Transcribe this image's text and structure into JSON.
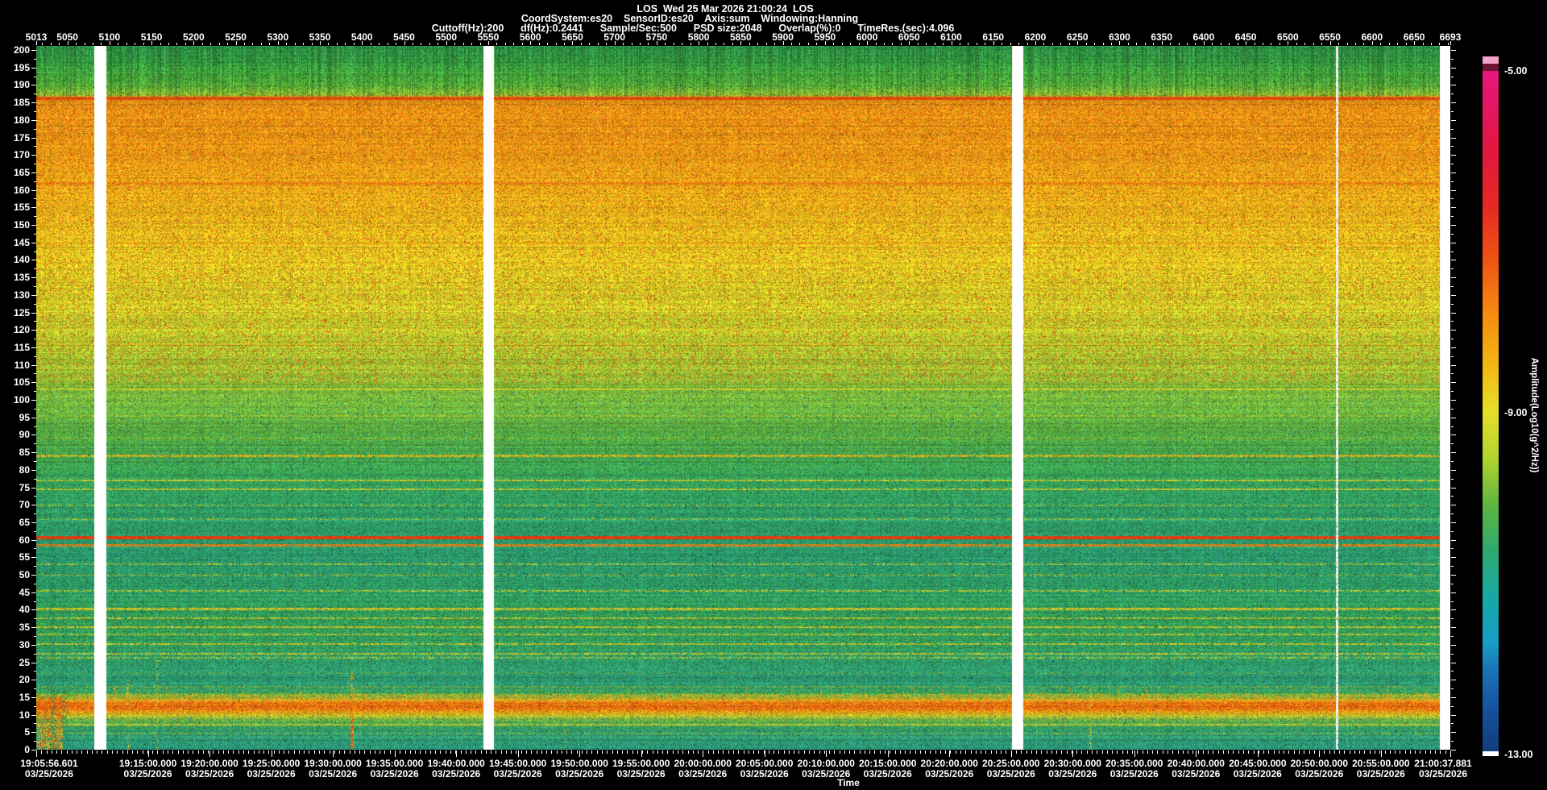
{
  "window": {
    "background": "#000000",
    "text_color": "#ffffff"
  },
  "header": {
    "title": "LOS  Wed 25 Mar 2026 21:00:24  LOS",
    "params_line": "CoordSystem:es20    SensorID:es20    Axis:sum    Windowing:Hanning",
    "settings_line": "Cuttoff(Hz):200      df(Hz):0.2441      Sample/Sec:500      PSD size:2048      Overlap(%):0      TimeRes.(sec):4.096"
  },
  "top_axis": {
    "range": [
      5013,
      6693
    ],
    "minor_tick_step": 10,
    "tick_labels": [
      5013,
      5050,
      5100,
      5150,
      5200,
      5250,
      5300,
      5350,
      5400,
      5450,
      5500,
      5550,
      5600,
      5650,
      5700,
      5750,
      5800,
      5850,
      5900,
      5950,
      6000,
      6050,
      6100,
      6150,
      6200,
      6250,
      6300,
      6350,
      6400,
      6450,
      6500,
      6550,
      6600,
      6650,
      6693
    ]
  },
  "left_axis": {
    "range_hz": [
      0,
      200
    ],
    "minor_tick_step": 2.5,
    "tick_labels": [
      200,
      195,
      190,
      185,
      180,
      175,
      170,
      165,
      160,
      155,
      150,
      145,
      140,
      135,
      130,
      125,
      120,
      115,
      110,
      105,
      100,
      95,
      90,
      85,
      80,
      75,
      70,
      65,
      60,
      55,
      50,
      45,
      40,
      35,
      30,
      25,
      20,
      15,
      10,
      5,
      0
    ]
  },
  "bottom_axis": {
    "label": "Time",
    "date_line": "03/25/2026",
    "start_time": "19:05:56.601",
    "end_time": "21:00:37.881",
    "interval_tick_times": [
      "19:15:00.000",
      "19:20:00.000",
      "19:25:00.000",
      "19:30:00.000",
      "19:35:00.000",
      "19:40:00.000",
      "19:45:00.000",
      "19:50:00.000",
      "19:55:00.000",
      "20:00:00.000",
      "20:05:00.000",
      "20:10:00.000",
      "20:15:00.000",
      "20:20:00.000",
      "20:25:00.000",
      "20:30:00.000",
      "20:35:00.000",
      "20:40:00.000",
      "20:45:00.000",
      "20:50:00.000",
      "20:55:00.000"
    ],
    "minor_tick_seconds": 24.576
  },
  "colorbar": {
    "title": "Amplitude(Log10(g^2/Hz))",
    "tick_labels": [
      "-5.00",
      "-9.00",
      "-13.00"
    ],
    "value_range": [
      -13,
      -5
    ],
    "top_cap_colors": [
      "#f2a2c6",
      "#701434"
    ],
    "bottom_cap_color": "#ffffff",
    "gradient_stops": [
      [
        "0%",
        "#e6187c"
      ],
      [
        "6%",
        "#e41560"
      ],
      [
        "12%",
        "#e2173e"
      ],
      [
        "20%",
        "#e62922"
      ],
      [
        "28%",
        "#ee5514"
      ],
      [
        "36%",
        "#f68c0e"
      ],
      [
        "44%",
        "#f2bc14"
      ],
      [
        "50%",
        "#e6de2a"
      ],
      [
        "57%",
        "#b2d42e"
      ],
      [
        "64%",
        "#5cb440"
      ],
      [
        "71%",
        "#2ca873"
      ],
      [
        "78%",
        "#16a8a8"
      ],
      [
        "84%",
        "#189ec6"
      ],
      [
        "88%",
        "#1a74b4"
      ],
      [
        "94%",
        "#16509a"
      ],
      [
        "100%",
        "#123c7c"
      ]
    ]
  },
  "chart_data": {
    "type": "heatmap",
    "subtype": "spectrogram",
    "title": "LOS  Wed 25 Mar 2026 21:00:24  LOS",
    "station": "LOS",
    "x_top_records": {
      "min": 5013,
      "max": 6693,
      "record_duration_sec": 4.096
    },
    "x_time": {
      "start": "19:05:56.601 03/25/2026",
      "end": "21:00:37.881 03/25/2026",
      "label": "Time"
    },
    "y_frequency_hz": [
      0,
      200
    ],
    "z_amplitude_log10_g2hz": [
      -13,
      -5
    ],
    "legend_position": "right",
    "data_gap_record_ranges": [
      [
        5082,
        5096
      ],
      [
        5544,
        5557
      ],
      [
        6172,
        6186
      ],
      [
        6681,
        6694
      ]
    ],
    "render": {
      "noise_seed": 1234567,
      "freq_color_profile": [
        [
          201,
          "#2e8f46"
        ],
        [
          196,
          "#379b3e"
        ],
        [
          190,
          "#55aa38"
        ],
        [
          187.5,
          "#8cb830"
        ],
        [
          186,
          "#d98a14"
        ],
        [
          183,
          "#ef9212"
        ],
        [
          170,
          "#f09a14"
        ],
        [
          160,
          "#eeaa16"
        ],
        [
          148,
          "#e9c01c"
        ],
        [
          136,
          "#e0d024"
        ],
        [
          124,
          "#c6d02a"
        ],
        [
          112,
          "#a4c832"
        ],
        [
          100,
          "#7cba3a"
        ],
        [
          90,
          "#58ac40"
        ],
        [
          80,
          "#3da452"
        ],
        [
          70,
          "#319c60"
        ],
        [
          62,
          "#2f9a66"
        ],
        [
          56,
          "#2c9868"
        ],
        [
          48,
          "#2e9a62"
        ],
        [
          42,
          "#339e58"
        ],
        [
          36,
          "#37a052"
        ],
        [
          30,
          "#35a05a"
        ],
        [
          24,
          "#309c68"
        ],
        [
          19,
          "#2e9a70"
        ],
        [
          16,
          "#44a452"
        ],
        [
          14.6,
          "#b0b42c"
        ],
        [
          13.6,
          "#ee8412"
        ],
        [
          12,
          "#ef7e10"
        ],
        [
          11,
          "#e89c16"
        ],
        [
          10,
          "#cdbc24"
        ],
        [
          9,
          "#8cb838"
        ],
        [
          8,
          "#5aaa46"
        ],
        [
          6.5,
          "#3ba05c"
        ],
        [
          5,
          "#339c6a"
        ],
        [
          2,
          "#2f9a74"
        ],
        [
          0,
          "#2e9678"
        ]
      ],
      "spectral_lines": [
        [
          186.3,
          2,
          "#e0480e",
          0.95
        ],
        [
          162,
          1.5,
          "#ee7410",
          0.65
        ],
        [
          145,
          1.5,
          "#eda012",
          0.6
        ],
        [
          139,
          1,
          "#e8bc16",
          0.4
        ],
        [
          127.5,
          1,
          "#ddc81e",
          0.4
        ],
        [
          120.5,
          1,
          "#dcca22",
          0.5
        ],
        [
          116,
          1,
          "#e2c01c",
          0.6
        ],
        [
          109,
          1,
          "#cfcc28",
          0.4
        ],
        [
          103,
          1,
          "#d8d028",
          0.65
        ],
        [
          95.5,
          1,
          "#c0cc2c",
          0.4
        ],
        [
          89,
          1,
          "#aac432",
          0.35
        ],
        [
          84,
          1.5,
          "#e6b41c",
          0.7
        ],
        [
          77,
          1,
          "#d6d02a",
          0.75
        ],
        [
          74.5,
          1,
          "#d6d02a",
          0.7
        ],
        [
          70,
          1,
          "#b0c830",
          0.4
        ],
        [
          66,
          1,
          "#c0c82c",
          0.35
        ],
        [
          60.6,
          2,
          "#e63c0e",
          0.97
        ],
        [
          58.6,
          1.5,
          "#ef7c12",
          0.8
        ],
        [
          53,
          1,
          "#c6cc2c",
          0.5
        ],
        [
          50,
          1,
          "#a8c434",
          0.3
        ],
        [
          45.5,
          1,
          "#cecc2a",
          0.55
        ],
        [
          40.3,
          1.5,
          "#dcc622",
          0.75
        ],
        [
          37.6,
          1,
          "#d8ca24",
          0.6
        ],
        [
          35.2,
          1,
          "#dcc822",
          0.7
        ],
        [
          33,
          1,
          "#d4cc26",
          0.6
        ],
        [
          30.2,
          1,
          "#d8ca24",
          0.65
        ],
        [
          27.6,
          1,
          "#dcc424",
          0.6
        ],
        [
          26.4,
          1,
          "#cccc2a",
          0.45
        ],
        [
          22,
          1,
          "#74b03c",
          0.3
        ],
        [
          18.2,
          1,
          "#8cb836",
          0.4
        ],
        [
          15.8,
          1,
          "#c8bc26",
          0.5
        ],
        [
          7.2,
          1,
          "#d8c824",
          0.7
        ],
        [
          4.8,
          1,
          "#9cbc34",
          0.35
        ]
      ],
      "vertical_streaks": [
        [
          5014,
          30,
          15,
          0.33,
          "#e05010"
        ],
        [
          5014,
          30,
          8,
          0.38,
          "#ddc020"
        ],
        [
          5030,
          6,
          62,
          0.22,
          "#1e7e52"
        ],
        [
          5044,
          5,
          55,
          0.18,
          "#1e7e52"
        ],
        [
          5037,
          3,
          16,
          0.4,
          "#e87c14"
        ],
        [
          5120,
          2,
          20,
          0.25,
          "#d8c024"
        ],
        [
          5156,
          2,
          26,
          0.2,
          "#d0c428"
        ],
        [
          5386,
          3,
          22,
          0.42,
          "#e0a018"
        ],
        [
          5386,
          2,
          14,
          0.3,
          "#e03c10"
        ],
        [
          5640,
          2,
          18,
          0.2,
          "#d0c428"
        ],
        [
          6264,
          2,
          18,
          0.38,
          "#d8b820"
        ],
        [
          6557,
          1.6,
          201,
          0.92,
          "#ffffff"
        ]
      ],
      "low_band_hz": {
        "core": [
          11.2,
          13.6
        ],
        "ragged_top_max": 16.3
      }
    }
  }
}
